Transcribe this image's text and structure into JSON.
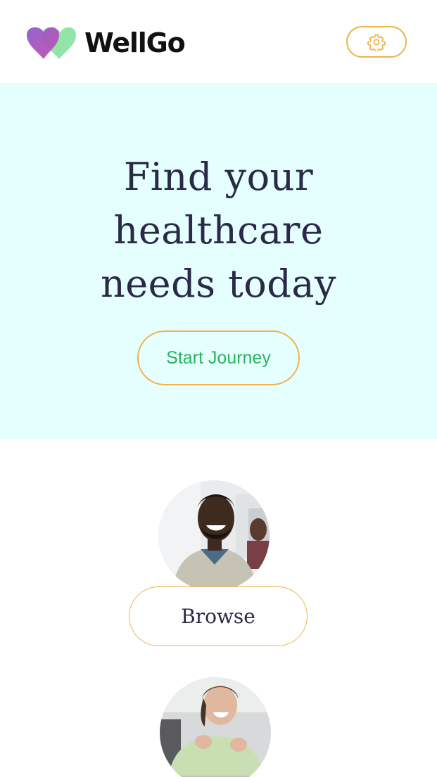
{
  "header": {
    "brand_name": "WellGo",
    "logo_icon": "two-hearts-icon",
    "settings_icon": "gear-icon"
  },
  "hero": {
    "title_lines": [
      "Find your",
      "healthcare",
      "needs today"
    ],
    "cta_label": "Start Journey"
  },
  "cards": [
    {
      "action_label": "Browse",
      "image": "smiling-man-portrait"
    },
    {
      "image": "laughing-woman-portrait"
    }
  ],
  "colors": {
    "hero_background": "#e5fffe",
    "accent_border": "#f0b24b",
    "cta_text": "#2bb35f",
    "heading_text": "#2a2a48",
    "logo_purple": "#9b59c4",
    "logo_green": "#8fe0a6"
  }
}
